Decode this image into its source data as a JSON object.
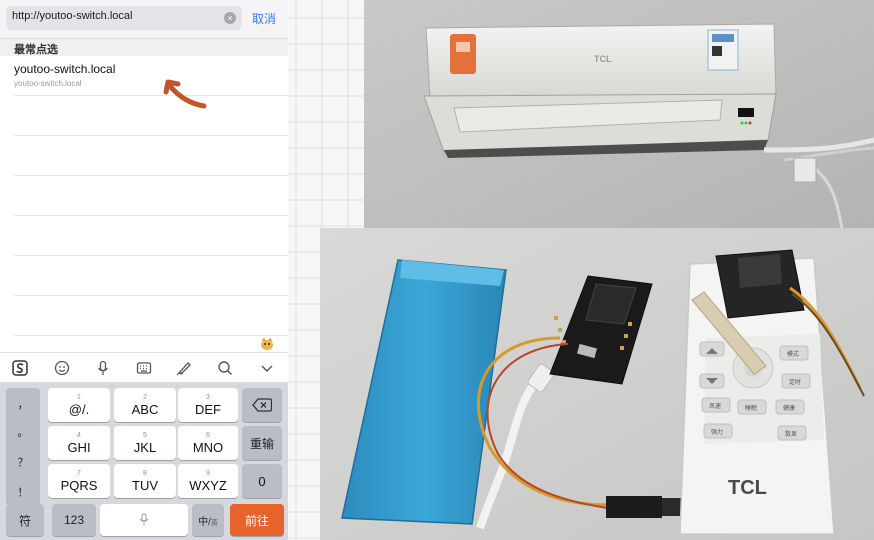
{
  "browser": {
    "url": "http://youtoo-switch.local",
    "cancel_label": "取消"
  },
  "suggestions": {
    "section_title": "最常点选",
    "items": [
      {
        "title": "youtoo-switch.local",
        "subtitle": "youtoo-switch.local"
      }
    ]
  },
  "keyboard_toolbar": {
    "icons": [
      "sogou-logo-icon",
      "emoji-icon",
      "microphone-icon",
      "keyboard-icon",
      "handwriting-icon",
      "search-icon",
      "collapse-chevron-icon"
    ]
  },
  "keyboard": {
    "symbols": [
      "，",
      "。",
      "？",
      "！"
    ],
    "rows": [
      [
        {
          "num": "1",
          "label": "@/."
        },
        {
          "num": "2",
          "label": "ABC"
        },
        {
          "num": "3",
          "label": "DEF"
        }
      ],
      [
        {
          "num": "4",
          "label": "GHI"
        },
        {
          "num": "5",
          "label": "JKL"
        },
        {
          "num": "6",
          "label": "MNO"
        }
      ],
      [
        {
          "num": "7",
          "label": "PQRS"
        },
        {
          "num": "8",
          "label": "TUV"
        },
        {
          "num": "9",
          "label": "WXYZ"
        }
      ]
    ],
    "reenter_label": "重输",
    "zero_label": "0",
    "symbol_label": "符",
    "number_label": "123",
    "lang_label": "中/",
    "lang_sub": "英",
    "go_label": "前往"
  },
  "photos": {
    "ac_brand": "TCL",
    "remote_brand": "TCL",
    "remote_buttons": [
      "模式",
      "定时",
      "风速",
      "睡眠",
      "健康",
      "强力",
      "数显"
    ]
  },
  "colors": {
    "accent_blue": "#2f7bf6",
    "go_orange": "#e8632c",
    "arrow_orange": "#c4552a"
  }
}
